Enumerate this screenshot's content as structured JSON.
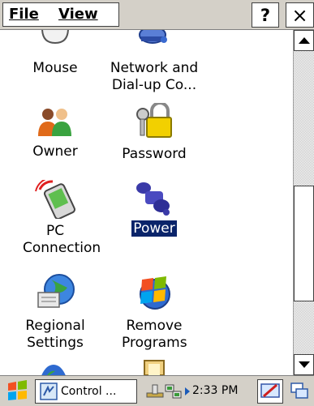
{
  "menubar": {
    "file": "File",
    "view": "View",
    "help": "?",
    "close": "×"
  },
  "items": [
    {
      "label": "Mouse",
      "icon": "mouse-icon"
    },
    {
      "label": "Network and Dial-up Co...",
      "icon": "network-icon"
    },
    {
      "label": "Owner",
      "icon": "owner-icon"
    },
    {
      "label": "Password",
      "icon": "password-icon"
    },
    {
      "label": "PC Connection",
      "icon": "pc-connection-icon"
    },
    {
      "label": "Power",
      "icon": "power-icon",
      "selected": true
    },
    {
      "label": "Regional Settings",
      "icon": "regional-settings-icon"
    },
    {
      "label": "Remove Programs",
      "icon": "remove-programs-icon"
    }
  ],
  "taskbar": {
    "task_label": "Control ...",
    "time": "2:33 PM"
  }
}
